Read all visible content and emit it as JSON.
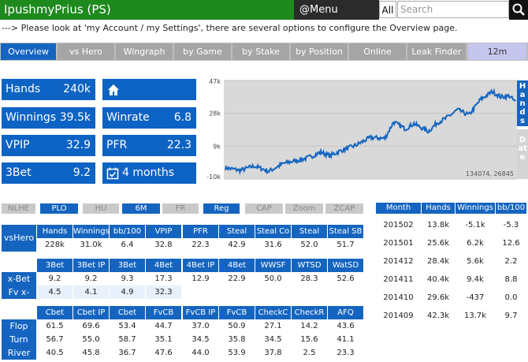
{
  "header": {
    "title": "IpushmyPrius (PS)",
    "menu_label": "@Menu",
    "search_scope": "All",
    "search_placeholder": "Search"
  },
  "notice": "---> Please look at 'my Account / my Settings', there are several options to configure the Overview page.",
  "tabs": [
    {
      "label": "Overview",
      "active": true
    },
    {
      "label": "vs Hero",
      "active": false
    },
    {
      "label": "Wingraph",
      "active": false
    },
    {
      "label": "by Game",
      "active": false
    },
    {
      "label": "by Stake",
      "active": false
    },
    {
      "label": "by Position",
      "active": false
    },
    {
      "label": "Online",
      "active": false
    },
    {
      "label": "Leak Finder",
      "active": false
    },
    {
      "label": "12m",
      "active": false
    }
  ],
  "stats": {
    "hands_label": "Hands",
    "hands_value": "240k",
    "winnings_label": "Winnings",
    "winnings_value": "39.5k",
    "winrate_label": "Winrate",
    "winrate_value": "6.8",
    "vpip_label": "VPIP",
    "vpip_value": "32.9",
    "pfr_label": "PFR",
    "pfr_value": "22.3",
    "threebet_label": "3Bet",
    "threebet_value": "9.2",
    "last_seen": "4 months ago"
  },
  "graph": {
    "y_ticks": [
      "47k",
      "28k",
      "9k",
      "-10k"
    ],
    "y_values": [
      47000,
      28000,
      9000,
      -10000
    ],
    "side_tab_hands": "Hands",
    "side_tab_date": "Date",
    "readout": "134074, 26845",
    "line_color": "#1565c0"
  },
  "filters": [
    {
      "label": "NLHE",
      "on": false
    },
    {
      "label": "PLO",
      "on": true
    },
    {
      "label": "HU",
      "on": false
    },
    {
      "label": "6M",
      "on": true
    },
    {
      "label": "FR",
      "on": false
    },
    {
      "label": "Reg",
      "on": true
    },
    {
      "label": "CAP",
      "on": false
    },
    {
      "label": "Zoom",
      "on": false
    },
    {
      "label": "ZCAP",
      "on": false
    }
  ],
  "table1": {
    "row_label": "vsHero",
    "headers": [
      "Hands",
      "Winnings",
      "bb/100",
      "VPIP",
      "PFR",
      "Steal",
      "Steal Co",
      "Steal BTN",
      "Steal SB"
    ],
    "values": [
      "228k",
      "31.0k",
      "6.4",
      "32.8",
      "22.3",
      "42.9",
      "31.6",
      "52.0",
      "51.7"
    ]
  },
  "table2": {
    "headers": [
      "3Bet",
      "3Bet IP",
      "3Bet OOP",
      "4Bet",
      "4Bet IP",
      "4Bet OOP",
      "WWSF",
      "WTSD",
      "WatSD"
    ],
    "rows": [
      {
        "label": "x-Bet",
        "values": [
          "9.2",
          "9.2",
          "9.3",
          "17.3",
          "12.9",
          "22.9",
          "50.0",
          "28.3",
          "52.6"
        ]
      },
      {
        "label": "Fv x-Bet",
        "values": [
          "4.5",
          "4.1",
          "4.9",
          "32.3",
          "",
          "",
          "",
          "",
          ""
        ]
      }
    ]
  },
  "table3": {
    "headers": [
      "Cbet",
      "Cbet IP",
      "Cbet OOP",
      "FvCB",
      "FvCB IP",
      "FvCB OOP",
      "CheckC",
      "CheckR",
      "AFQ"
    ],
    "rows": [
      {
        "label": "Flop",
        "values": [
          "61.5",
          "69.6",
          "53.4",
          "44.7",
          "37.0",
          "50.9",
          "27.1",
          "14.2",
          "43.6"
        ]
      },
      {
        "label": "Turn",
        "values": [
          "56.7",
          "55.0",
          "58.7",
          "35.1",
          "34.5",
          "35.8",
          "34.5",
          "15.6",
          "41.1"
        ]
      },
      {
        "label": "River",
        "values": [
          "40.5",
          "45.8",
          "36.7",
          "47.6",
          "44.0",
          "53.9",
          "37.8",
          "2.5",
          "23.3"
        ]
      }
    ]
  },
  "months": {
    "headers": [
      "Month",
      "Hands",
      "Winnings",
      "bb/100"
    ],
    "rows": [
      [
        "201502",
        "13.8k",
        "-5.1k",
        "-5.3"
      ],
      [
        "201501",
        "25.6k",
        "6.2k",
        "12.6"
      ],
      [
        "201412",
        "28.4k",
        "5.6k",
        "2.2"
      ],
      [
        "201411",
        "40.4k",
        "9.4k",
        "8.8"
      ],
      [
        "201410",
        "29.6k",
        "-437",
        "0.0"
      ],
      [
        "201409",
        "42.3k",
        "13.7k",
        "9.7"
      ]
    ]
  }
}
